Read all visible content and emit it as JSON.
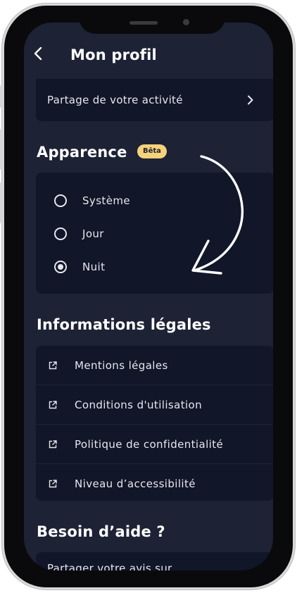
{
  "header": {
    "back_icon": "chevron-left-icon",
    "title": "Mon profil"
  },
  "activity": {
    "label": "Partage de votre activité",
    "chevron_icon": "chevron-right-icon"
  },
  "appearance": {
    "title": "Apparence",
    "badge": "Bêta",
    "badge_color": "#f6d27a",
    "options": [
      {
        "label": "Système",
        "selected": false
      },
      {
        "label": "Jour",
        "selected": false
      },
      {
        "label": "Nuit",
        "selected": true
      }
    ]
  },
  "legal": {
    "title": "Informations légales",
    "items": [
      {
        "label": "Mentions légales",
        "icon": "external-link-icon"
      },
      {
        "label": "Conditions d'utilisation",
        "icon": "external-link-icon"
      },
      {
        "label": "Politique de confidentialité",
        "icon": "external-link-icon"
      },
      {
        "label": "Niveau d’accessibilité",
        "icon": "external-link-icon"
      }
    ]
  },
  "help": {
    "title": "Besoin d’aide ?",
    "feedback_label": "Partager votre avis sur l'application",
    "chevron_icon": "chevron-right-icon"
  },
  "colors": {
    "background": "#1d2235",
    "card": "#111628",
    "text": "#e6e8ef"
  }
}
